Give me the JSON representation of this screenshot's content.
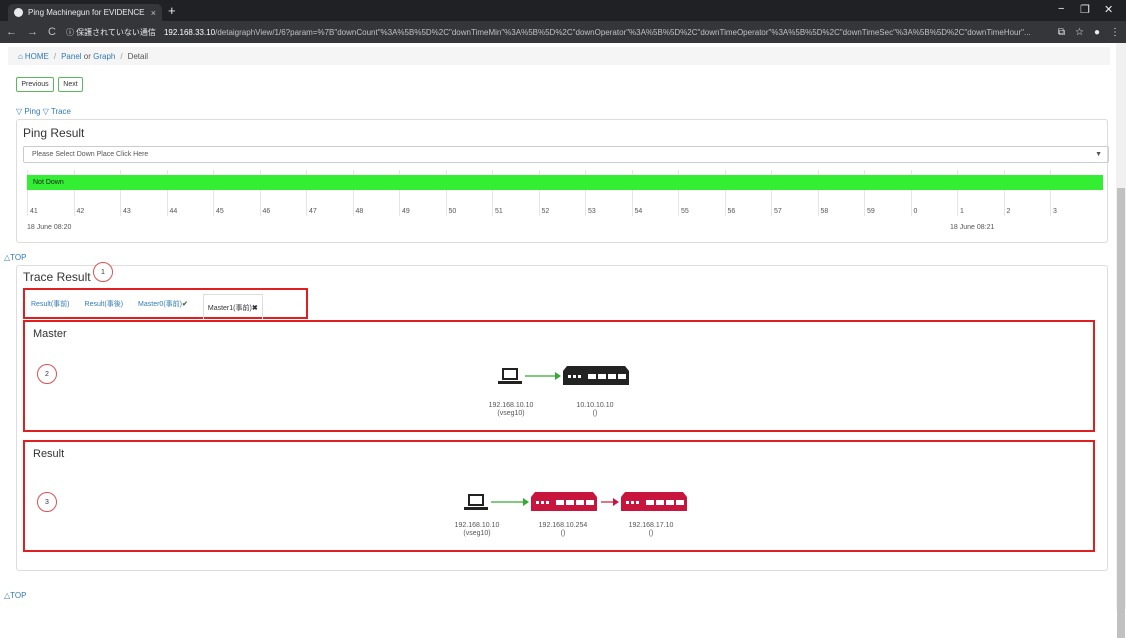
{
  "browser": {
    "tab_title": "Ping Machinegun for EVIDENCE",
    "tab_close": "×",
    "new_tab": "+",
    "security_label": "ⓘ 保護されていない通信",
    "url_host": "192.168.33.10",
    "url_path": "/detaigraphView/1/6?param=%7B\"downCount\"%3A%5B%5D%2C\"downTimeMin\"%3A%5B%5D%2C\"downOperator\"%3A%5B%5D%2C\"downTimeOperator\"%3A%5B%5D%2C\"downTimeSec\"%3A%5B%5D%2C\"downTimeHour\"..."
  },
  "breadcrumb": {
    "home": "HOME",
    "sep1": "/",
    "panel": "Panel",
    "or": " or ",
    "graph": "Graph",
    "sep2": "/",
    "current": "Detail"
  },
  "pager": {
    "previous": "Previous",
    "next": "Next"
  },
  "section_links": {
    "ping": "▽ Ping",
    "trace": "▽ Trace"
  },
  "ping": {
    "title": "Ping Result",
    "select_placeholder": "Please Select Down Place Click Here",
    "status_bar": "Not Down",
    "bar_color": "#33ee33",
    "ticks": [
      "41",
      "42",
      "43",
      "44",
      "45",
      "46",
      "47",
      "48",
      "49",
      "50",
      "51",
      "52",
      "53",
      "54",
      "55",
      "56",
      "57",
      "58",
      "59",
      "0",
      "1",
      "2",
      "3"
    ],
    "time_start": "18 June 08:20",
    "time_end": "18 June 08:21"
  },
  "top_link": "△TOP",
  "trace": {
    "title": "Trace Result",
    "tabs": [
      "Result(事前)",
      "Result(事後)",
      "Master0(事前)",
      "Master1(事前)"
    ],
    "master_title": "Master",
    "master_nodes": [
      {
        "ip": "192.168.10.10",
        "sub": "(vseg10)"
      },
      {
        "ip": "10.10.10.10",
        "sub": "()"
      }
    ],
    "result_title": "Result",
    "result_nodes": [
      {
        "ip": "192.168.10.10",
        "sub": "(vseg10)"
      },
      {
        "ip": "192.168.10.254",
        "sub": "()"
      },
      {
        "ip": "192.168.17.10",
        "sub": "()"
      }
    ]
  },
  "annotations": [
    "1",
    "2",
    "3"
  ],
  "colors": {
    "annotation_red": "#e02020",
    "switch_ok": "#222222",
    "switch_ng": "#c8153d",
    "link_ok": "#33aa33",
    "link_ng": "#c8153d"
  }
}
